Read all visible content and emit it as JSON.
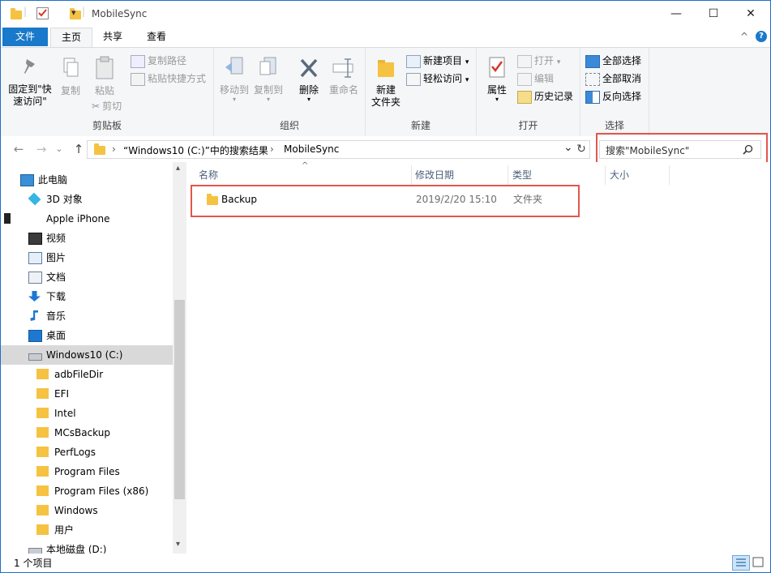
{
  "window": {
    "title": "MobileSync",
    "minimize_glyph": "—",
    "maximize_glyph": "☐",
    "close_glyph": "✕",
    "qa_dropdown_glyph": "▾",
    "ribbon_toggle_glyph": "^",
    "help_glyph": "?"
  },
  "tabs": {
    "file": "文件",
    "home": "主页",
    "share": "共享",
    "view": "查看"
  },
  "ribbon": {
    "clipboard": {
      "label": "剪贴板",
      "pin_line1": "固定到\"快",
      "pin_line2": "速访问\"",
      "copy": "复制",
      "paste": "粘贴",
      "copy_path": "复制路径",
      "paste_shortcut": "粘贴快捷方式",
      "cut": "剪切"
    },
    "organize": {
      "label": "组织",
      "move_to": "移动到",
      "copy_to": "复制到",
      "delete": "删除",
      "rename": "重命名"
    },
    "new": {
      "label": "新建",
      "new_folder_line1": "新建",
      "new_folder_line2": "文件夹",
      "new_item": "新建项目",
      "easy_access": "轻松访问"
    },
    "open": {
      "label": "打开",
      "properties": "属性",
      "open": "打开",
      "edit": "编辑",
      "history": "历史记录"
    },
    "select": {
      "label": "选择",
      "select_all": "全部选择",
      "select_none": "全部取消",
      "invert": "反向选择"
    }
  },
  "address": {
    "crumb1": "“Windows10 (C:)”中的搜索结果",
    "crumb2": "MobileSync",
    "separator": "›",
    "dropdown_glyph": "⌄",
    "refresh_glyph": "↻"
  },
  "search": {
    "placeholder": "搜索\"MobileSync\""
  },
  "nav_buttons": {
    "back": "←",
    "forward": "→",
    "recent": "⌄",
    "up": "↑"
  },
  "navpane": {
    "items": [
      {
        "label": "此电脑",
        "icon": "pc-icon"
      },
      {
        "label": "3D 对象",
        "icon": "3d-objects-icon"
      },
      {
        "label": "Apple iPhone",
        "icon": "iphone-icon"
      },
      {
        "label": "视频",
        "icon": "video-icon"
      },
      {
        "label": "图片",
        "icon": "pictures-icon"
      },
      {
        "label": "文档",
        "icon": "documents-icon"
      },
      {
        "label": "下载",
        "icon": "downloads-icon"
      },
      {
        "label": "音乐",
        "icon": "music-icon"
      },
      {
        "label": "桌面",
        "icon": "desktop-icon"
      },
      {
        "label": "Windows10 (C:)",
        "icon": "drive-icon"
      },
      {
        "label": "adbFileDir",
        "icon": "folder-icon"
      },
      {
        "label": "EFI",
        "icon": "folder-icon"
      },
      {
        "label": "Intel",
        "icon": "folder-icon"
      },
      {
        "label": "MCsBackup",
        "icon": "folder-icon"
      },
      {
        "label": "PerfLogs",
        "icon": "folder-icon"
      },
      {
        "label": "Program Files",
        "icon": "folder-icon"
      },
      {
        "label": "Program Files (x86)",
        "icon": "folder-icon"
      },
      {
        "label": "Windows",
        "icon": "folder-icon"
      },
      {
        "label": "用户",
        "icon": "folder-icon"
      },
      {
        "label": "本地磁盘 (D:)",
        "icon": "drive-icon"
      }
    ],
    "scroll_up_glyph": "▴",
    "scroll_down_glyph": "▾"
  },
  "columns": {
    "name": "名称",
    "date": "修改日期",
    "type": "类型",
    "size": "大小",
    "sort_glyph": "^"
  },
  "files": [
    {
      "name": "Backup",
      "date": "2019/2/20 15:10",
      "type": "文件夹",
      "size": ""
    }
  ],
  "status": {
    "count": "1 个项目"
  },
  "colors": {
    "accent": "#1979ca",
    "highlight": "#e2564d",
    "folder": "#f5c242"
  }
}
